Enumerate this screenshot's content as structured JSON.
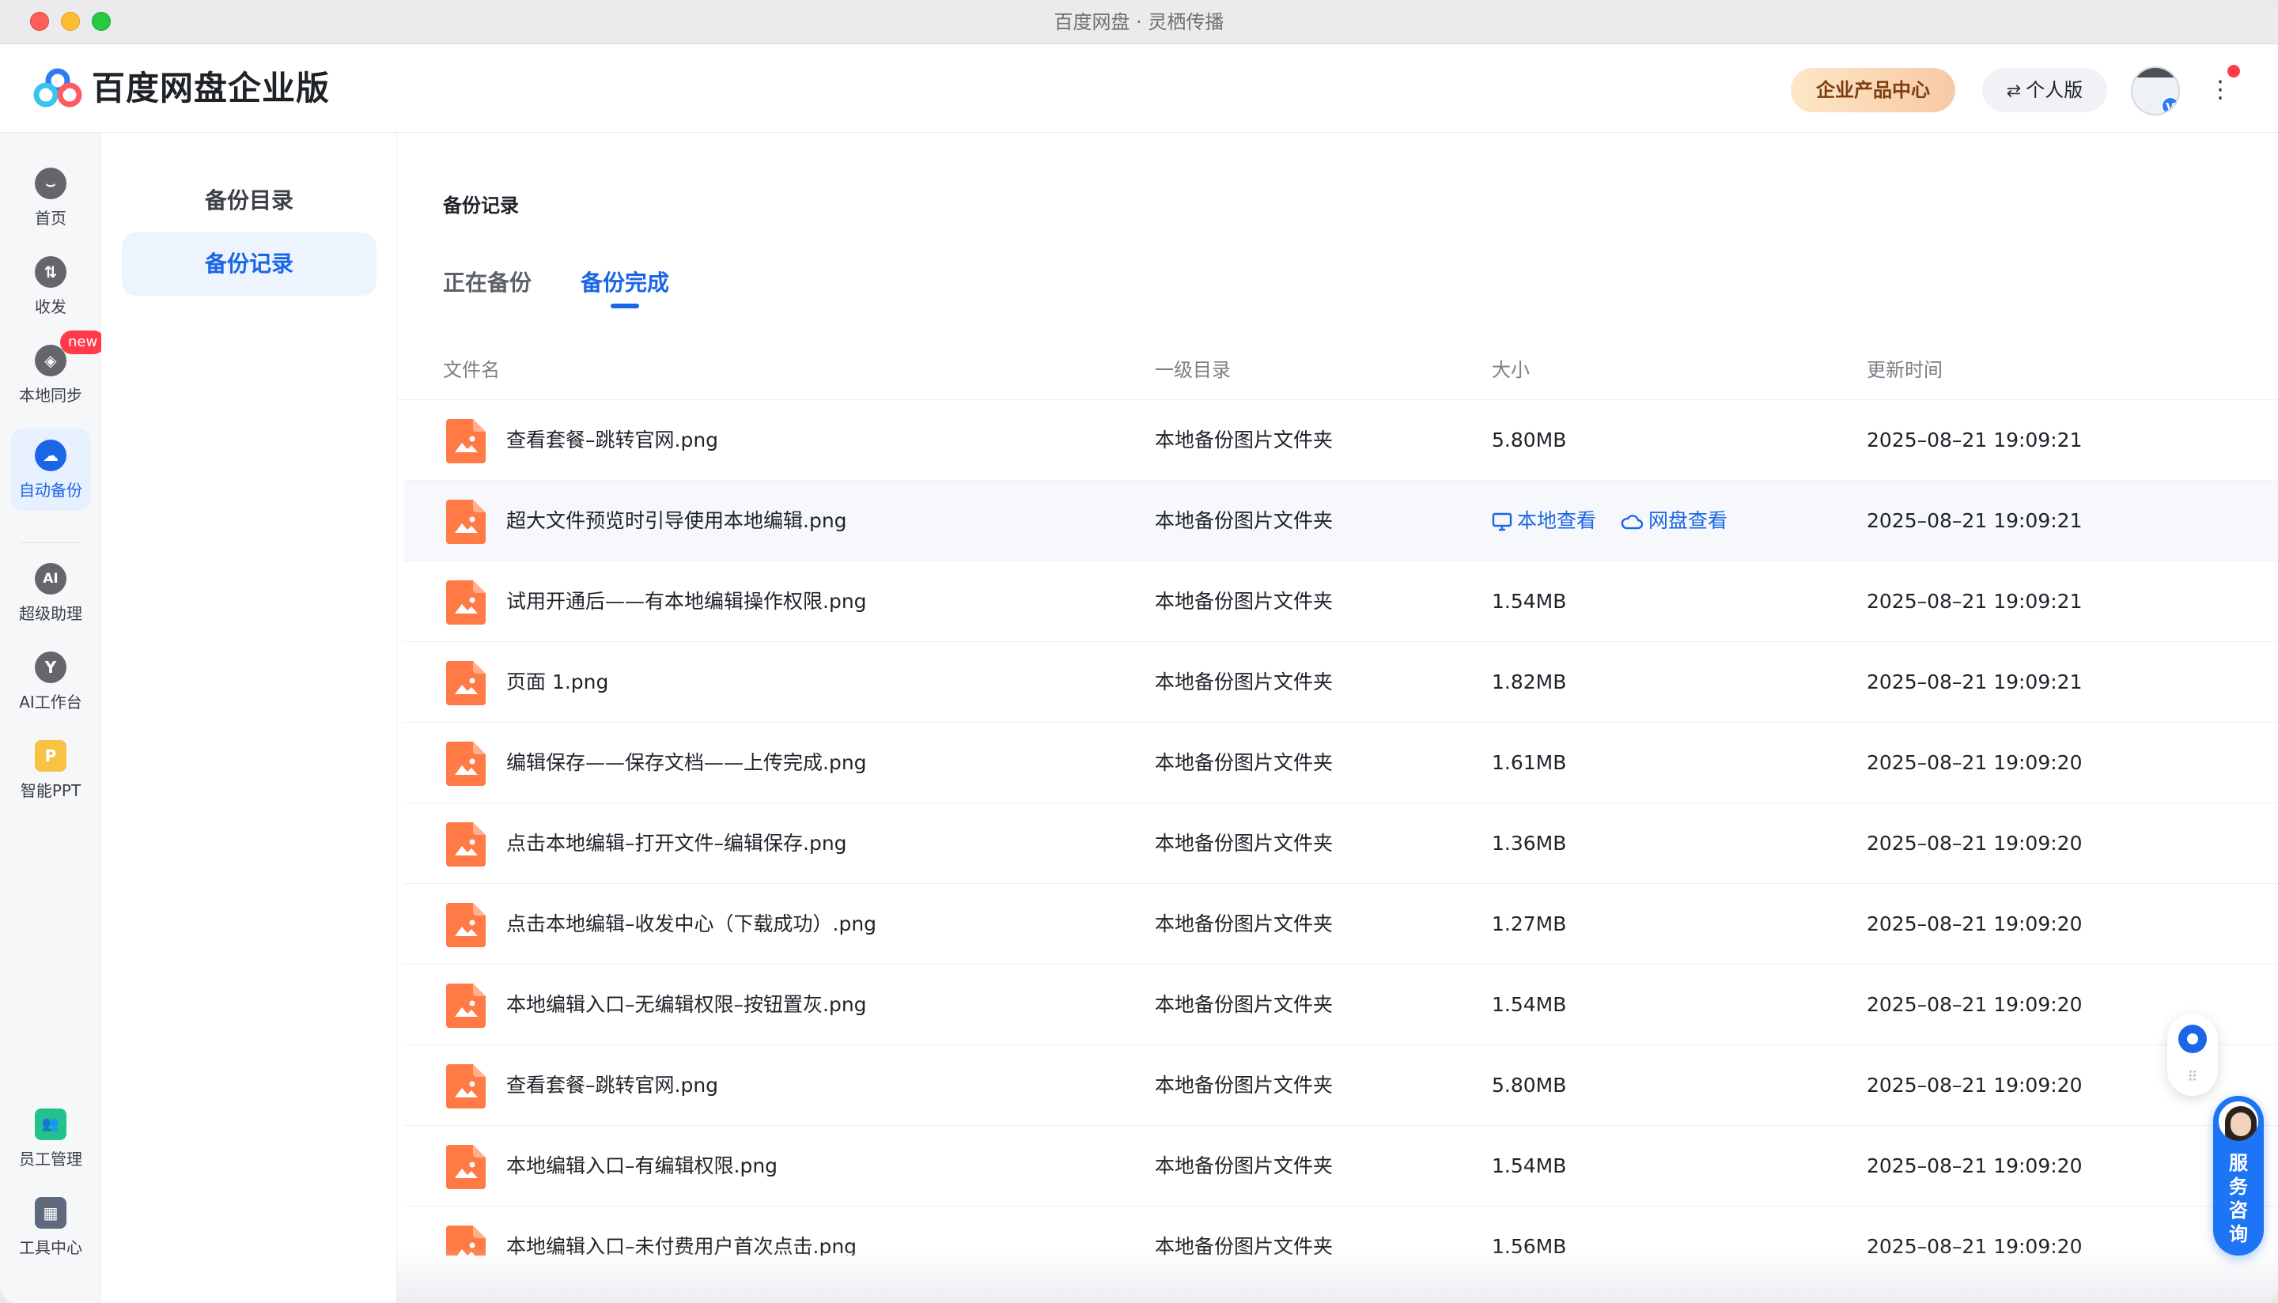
{
  "window": {
    "title": "百度网盘 · 灵栖传播"
  },
  "header": {
    "brand": "百度网盘企业版",
    "product_center": "企业产品中心",
    "personal": "个人版",
    "avatar_badge": "V",
    "more": "⋮"
  },
  "rail": {
    "items": [
      {
        "label": "首页",
        "icon": "home-icon",
        "glyph": "⌣"
      },
      {
        "label": "收发",
        "icon": "transfer-icon",
        "glyph": "⇅"
      },
      {
        "label": "本地同步",
        "icon": "sync-icon",
        "glyph": "◈",
        "badge": "new"
      },
      {
        "label": "自动备份",
        "icon": "cloud-backup-icon",
        "glyph": "☁"
      },
      {
        "label": "超级助理",
        "icon": "ai-assistant-icon",
        "glyph": "AI"
      },
      {
        "label": "AI工作台",
        "icon": "ai-workbench-icon",
        "glyph": "Y"
      },
      {
        "label": "智能PPT",
        "icon": "ppt-icon",
        "glyph": "P"
      },
      {
        "label": "员工管理",
        "icon": "staff-icon",
        "glyph": "👥"
      },
      {
        "label": "工具中心",
        "icon": "tools-icon",
        "glyph": "▦"
      }
    ]
  },
  "subnav": {
    "items": [
      {
        "label": "备份目录"
      },
      {
        "label": "备份记录"
      }
    ]
  },
  "main": {
    "title": "备份记录",
    "tabs": [
      {
        "label": "正在备份"
      },
      {
        "label": "备份完成"
      }
    ],
    "columns": {
      "name": "文件名",
      "dir": "一级目录",
      "size": "大小",
      "time": "更新时间"
    },
    "row_actions": {
      "local_view": "本地查看",
      "cloud_view": "网盘查看"
    },
    "rows": [
      {
        "name": "查看套餐–跳转官网.png",
        "dir": "本地备份图片文件夹",
        "size": "5.80MB",
        "time": "2025–08–21 19:09:21"
      },
      {
        "name": "超大文件预览时引导使用本地编辑.png",
        "dir": "本地备份图片文件夹",
        "size": "",
        "time": "2025–08–21 19:09:21"
      },
      {
        "name": "试用开通后——有本地编辑操作权限.png",
        "dir": "本地备份图片文件夹",
        "size": "1.54MB",
        "time": "2025–08–21 19:09:21"
      },
      {
        "name": "页面 1.png",
        "dir": "本地备份图片文件夹",
        "size": "1.82MB",
        "time": "2025–08–21 19:09:21"
      },
      {
        "name": "编辑保存——保存文档——上传完成.png",
        "dir": "本地备份图片文件夹",
        "size": "1.61MB",
        "time": "2025–08–21 19:09:20"
      },
      {
        "name": "点击本地编辑–打开文件–编辑保存.png",
        "dir": "本地备份图片文件夹",
        "size": "1.36MB",
        "time": "2025–08–21 19:09:20"
      },
      {
        "name": "点击本地编辑–收发中心（下载成功）.png",
        "dir": "本地备份图片文件夹",
        "size": "1.27MB",
        "time": "2025–08–21 19:09:20"
      },
      {
        "name": "本地编辑入口–无编辑权限–按钮置灰.png",
        "dir": "本地备份图片文件夹",
        "size": "1.54MB",
        "time": "2025–08–21 19:09:20"
      },
      {
        "name": "查看套餐–跳转官网.png",
        "dir": "本地备份图片文件夹",
        "size": "5.80MB",
        "time": "2025–08–21 19:09:20"
      },
      {
        "name": "本地编辑入口–有编辑权限.png",
        "dir": "本地备份图片文件夹",
        "size": "1.54MB",
        "time": "2025–08–21 19:09:20"
      },
      {
        "name": "本地编辑入口–未付费用户首次点击.png",
        "dir": "本地备份图片文件夹",
        "size": "1.56MB",
        "time": "2025–08–21 19:09:20"
      }
    ]
  },
  "service": {
    "label": "服务咨询",
    "grip": "⠿"
  },
  "colors": {
    "accent": "#1a66e6",
    "file_icon": "#ff7a45"
  }
}
